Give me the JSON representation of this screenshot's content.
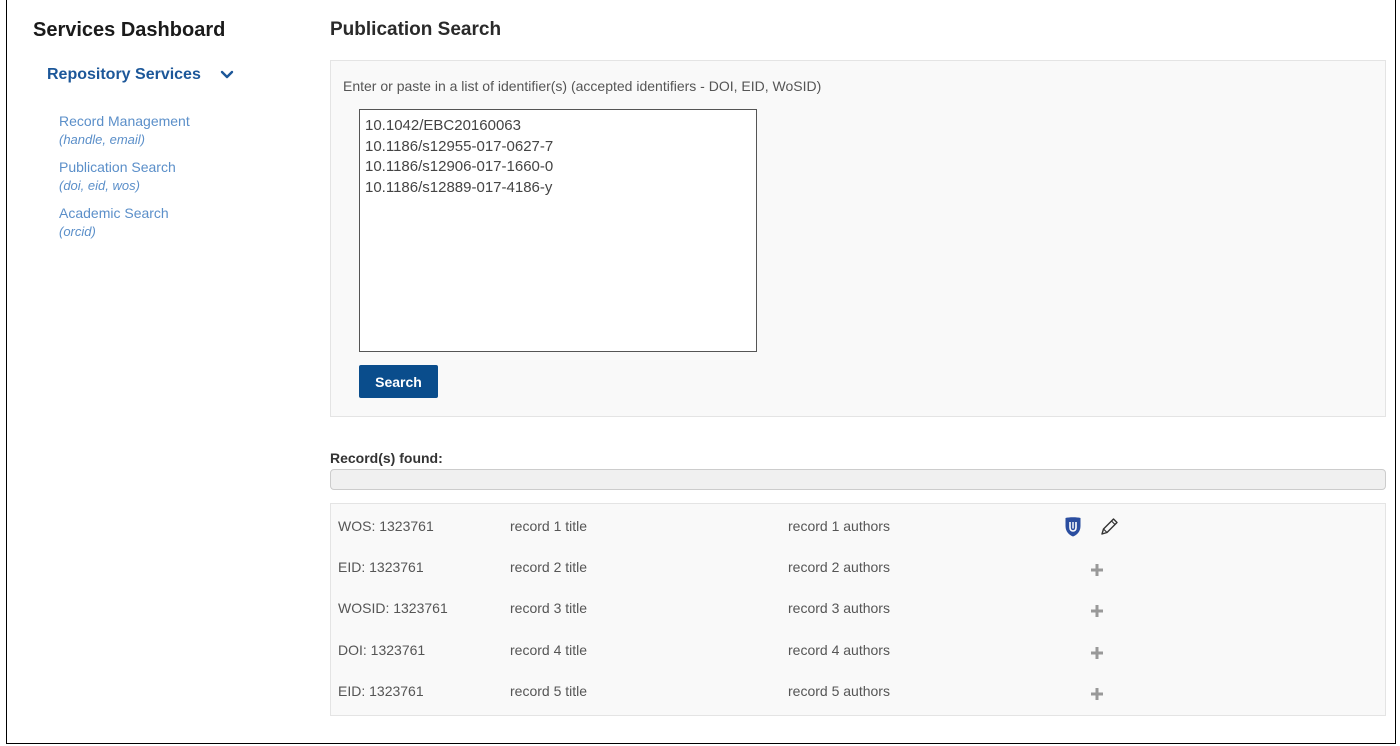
{
  "sidebar": {
    "app_title": "Services Dashboard",
    "section": {
      "label": "Repository Services",
      "toggle_icon": "chevron-down-icon"
    },
    "items": [
      {
        "label": "Record Management",
        "sub": "(handle, email)"
      },
      {
        "label": "Publication Search",
        "sub": "(doi, eid, wos)"
      },
      {
        "label": "Academic Search",
        "sub": "(orcid)"
      }
    ]
  },
  "main": {
    "title": "Publication Search",
    "instructions": "Enter or paste in a list of identifier(s) (accepted identifiers - DOI, EID, WoSID)",
    "identifiers_value": "10.1042/EBC20160063\n10.1186/s12955-017-0627-7\n10.1186/s12906-017-1660-0\n10.1186/s12889-017-4186-y",
    "search_label": "Search",
    "records_label": "Record(s) found:",
    "progress_percent": 0,
    "records": [
      {
        "id": "WOS: 1323761",
        "title": "record 1 title",
        "authors": "record 1 authors",
        "actions": [
          "shield-icon",
          "pencil-icon"
        ]
      },
      {
        "id": "EID: 1323761",
        "title": "record 2 title",
        "authors": "record 2 authors",
        "actions": [
          "plus-icon"
        ]
      },
      {
        "id": "WOSID: 1323761",
        "title": "record 3 title",
        "authors": "record 3 authors",
        "actions": [
          "plus-icon"
        ]
      },
      {
        "id": "DOI: 1323761",
        "title": "record 4 title",
        "authors": "record 4 authors",
        "actions": [
          "plus-icon"
        ]
      },
      {
        "id": "EID: 1323761",
        "title": "record 5 title",
        "authors": "record 5 authors",
        "actions": [
          "plus-icon"
        ]
      }
    ]
  },
  "colors": {
    "brand_blue": "#0a4d8c",
    "link_blue": "#5b8fc9",
    "section_blue": "#1c5799",
    "shield_blue": "#2b4ea0"
  }
}
